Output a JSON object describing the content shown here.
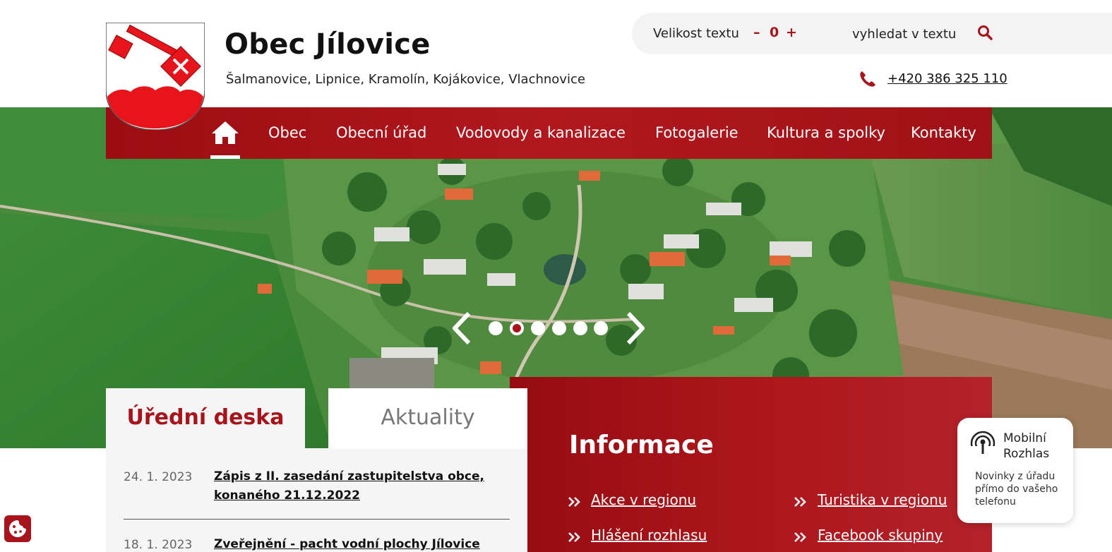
{
  "header": {
    "title": "Obec Jílovice",
    "subtitle": "Šalmanovice, Lipnice, Kramolín, Kojákovice, Vlachnovice",
    "text_size_label": "Velikost textu",
    "text_size_minus": "–",
    "text_size_value": "0",
    "text_size_plus": "+",
    "search_placeholder": "vyhledat v textu",
    "phone": "+420 386 325 110"
  },
  "nav": {
    "items": [
      "Obec",
      "Obecní úřad",
      "Vodovody a kanalizace",
      "Fotogalerie",
      "Kultura a spolky",
      "Kontakty"
    ]
  },
  "slider": {
    "dot_count": 6,
    "active_index": 1
  },
  "tabs": {
    "active": "Úřední deska",
    "inactive": "Aktuality"
  },
  "board": {
    "items": [
      {
        "date": "24. 1. 2023",
        "title": "Zápis z II. zasedání zastupitelstva obce, konaného 21.12.2022"
      },
      {
        "date": "18. 1. 2023",
        "title": "Zveřejnění - pacht vodní plochy Jílovice"
      }
    ]
  },
  "info": {
    "title": "Informace",
    "links": [
      "Akce v regionu",
      "Turistika v regionu",
      "Hlášení rozhlasu",
      "Facebook skupiny"
    ]
  },
  "mobile_rozhlas": {
    "title": "Mobilní Rozhlas",
    "description": "Novinky z úřadu přímo do vašeho telefonu"
  },
  "colors": {
    "brand": "#a8141b",
    "toolbar_bg": "#f3f3f3"
  },
  "icons": [
    "crest-logo",
    "search-icon",
    "phone-icon",
    "home-icon",
    "chevron-left-icon",
    "chevron-right-icon",
    "double-chevron-icon",
    "broadcast-icon",
    "cookie-icon"
  ]
}
